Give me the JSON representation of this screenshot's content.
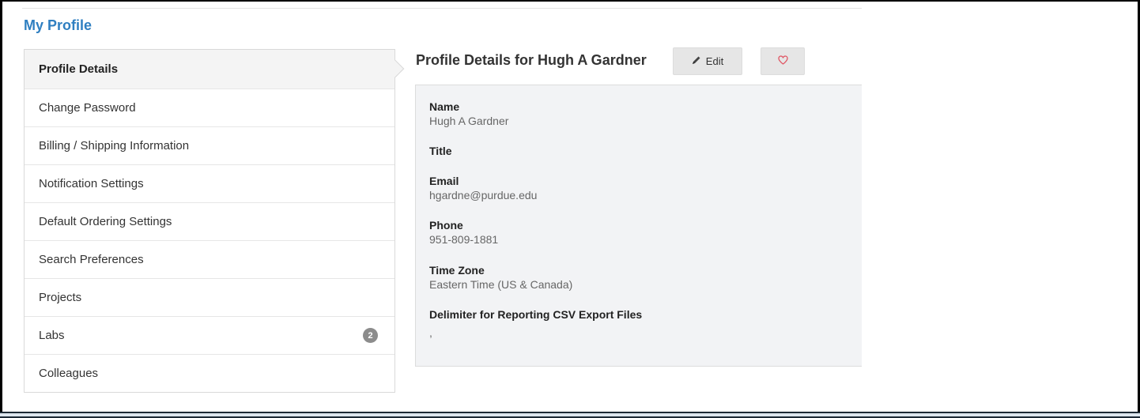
{
  "page": {
    "title": "My Profile"
  },
  "nav": {
    "items": [
      {
        "label": "Profile Details",
        "active": true
      },
      {
        "label": "Change Password"
      },
      {
        "label": "Billing / Shipping Information"
      },
      {
        "label": "Notification Settings"
      },
      {
        "label": "Default Ordering Settings"
      },
      {
        "label": "Search Preferences"
      },
      {
        "label": "Projects"
      },
      {
        "label": "Labs",
        "badge": "2"
      },
      {
        "label": "Colleagues"
      }
    ]
  },
  "content": {
    "title": "Profile Details for Hugh A Gardner",
    "edit_label": "Edit",
    "edit_icon": "pencil-icon",
    "favorite_icon": "heart-outline-icon",
    "accent_color": "#2f7fc1",
    "heart_color": "#e05563"
  },
  "profile": {
    "name_label": "Name",
    "name": "Hugh A Gardner",
    "title_label": "Title",
    "title": "",
    "email_label": "Email",
    "email": "hgardne@purdue.edu",
    "phone_label": "Phone",
    "phone": "951-809-1881",
    "timezone_label": "Time Zone",
    "timezone": "Eastern Time (US & Canada)",
    "delimiter_label": "Delimiter for Reporting CSV Export Files",
    "delimiter": ","
  }
}
